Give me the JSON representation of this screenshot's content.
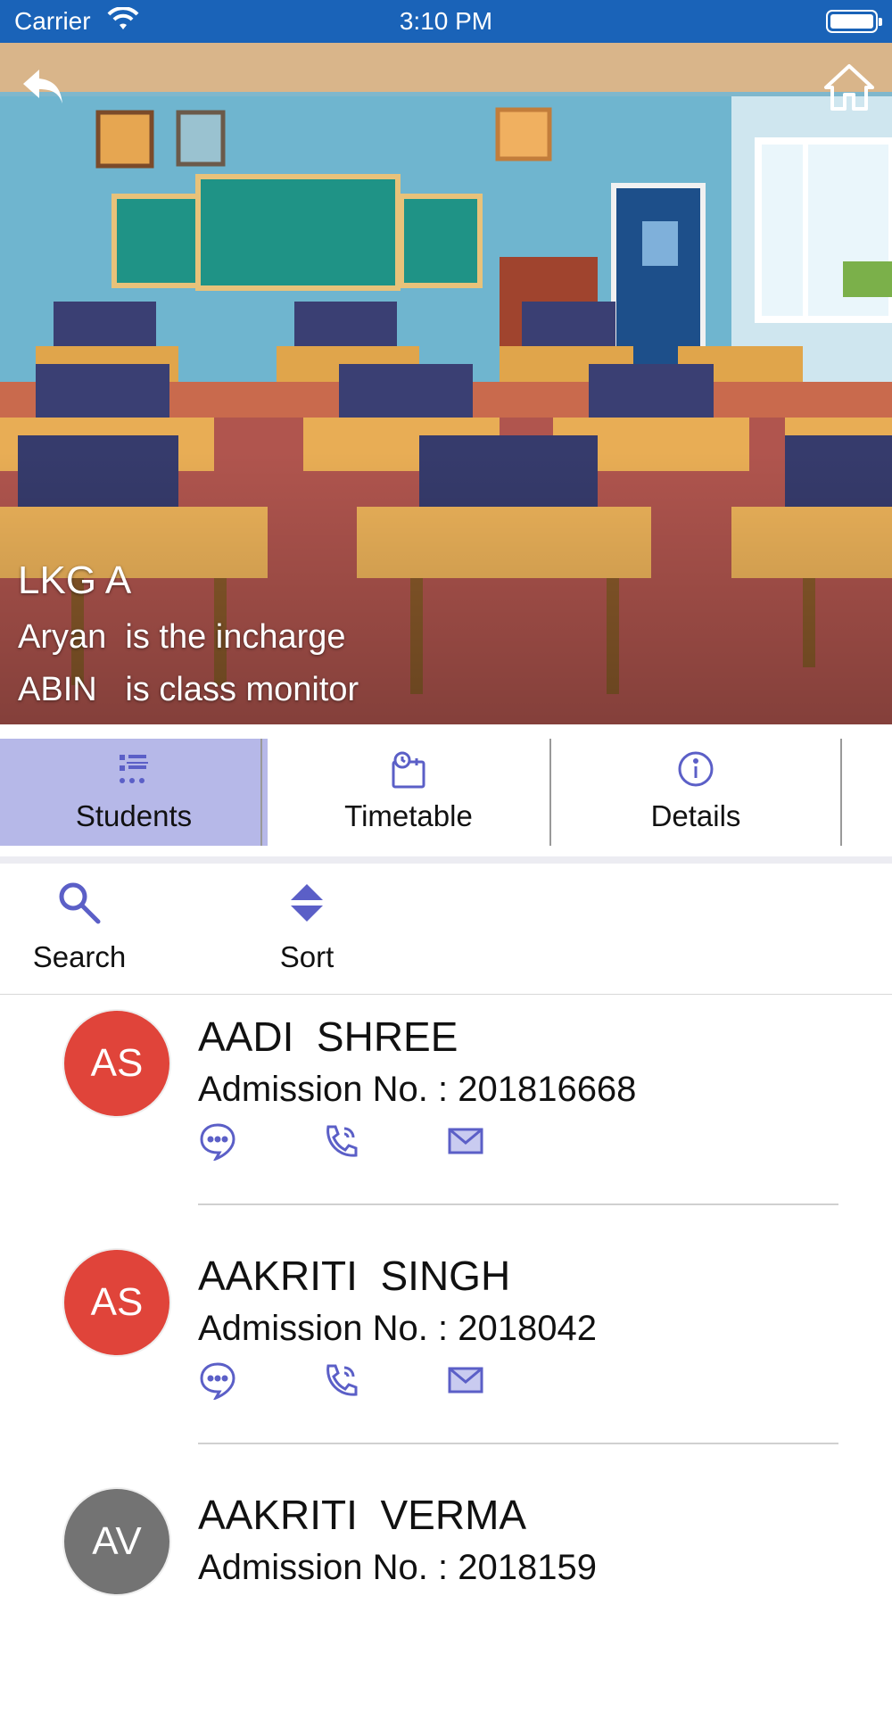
{
  "status_bar": {
    "carrier": "Carrier",
    "time": "3:10 PM"
  },
  "hero": {
    "class_name": "LKG A",
    "incharge_text": "Aryan  is the incharge",
    "monitor_text": "ABIN   is class monitor"
  },
  "tabs": [
    {
      "label": "Students",
      "icon": "students-icon",
      "active": true
    },
    {
      "label": "Timetable",
      "icon": "timetable-icon",
      "active": false
    },
    {
      "label": "Details",
      "icon": "info-icon",
      "active": false
    }
  ],
  "toolbar": {
    "search_label": "Search",
    "sort_label": "Sort"
  },
  "students": [
    {
      "initials": "AS",
      "name": "AADI  SHREE",
      "admission": "Admission No. : 201816668",
      "avatar_color": "#e0443a"
    },
    {
      "initials": "AS",
      "name": "AAKRITI  SINGH",
      "admission": "Admission No. : 2018042",
      "avatar_color": "#e0443a"
    },
    {
      "initials": "AV",
      "name": "AAKRITI  VERMA",
      "admission": "Admission No. : 2018159",
      "avatar_color": "#737373"
    }
  ],
  "colors": {
    "status_bar": "#1a63b8",
    "accent": "#5b5fc7",
    "active_tab": "#b6b8e8"
  }
}
